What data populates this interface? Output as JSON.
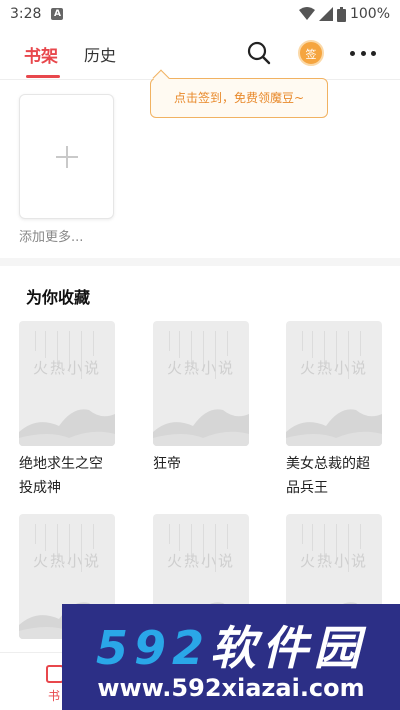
{
  "status": {
    "time": "3:28",
    "notif": "A",
    "battery": "100%"
  },
  "header": {
    "tab_shelf": "书架",
    "tab_history": "历史",
    "sign_badge": "签"
  },
  "tooltip": {
    "text": "点击签到，免费领魔豆~"
  },
  "add": {
    "label": "添加更多..."
  },
  "section": {
    "title": "为你收藏"
  },
  "books": [
    {
      "title": "绝地求生之空投成神",
      "cover_text": "火热小说"
    },
    {
      "title": "狂帝",
      "cover_text": "火热小说"
    },
    {
      "title": "美女总裁的超品兵王",
      "cover_text": "火热小说"
    },
    {
      "title": "",
      "cover_text": "火热小说"
    },
    {
      "title": "",
      "cover_text": "火热小说"
    },
    {
      "title": "",
      "cover_text": "火热小说"
    }
  ],
  "bottom_nav": {
    "shelf_label": "书"
  },
  "watermark": {
    "brand": "592软件园",
    "url": "www.592xiazai.com"
  },
  "colors": {
    "accent": "#e8474c",
    "sign": "#f5a540",
    "tooltip_text": "#e8892b",
    "watermark_bg": "#2c2f86"
  },
  "icons": [
    "search-icon",
    "sign-in-icon",
    "more-icon",
    "plus-icon",
    "wifi-icon",
    "signal-icon",
    "battery-icon"
  ]
}
